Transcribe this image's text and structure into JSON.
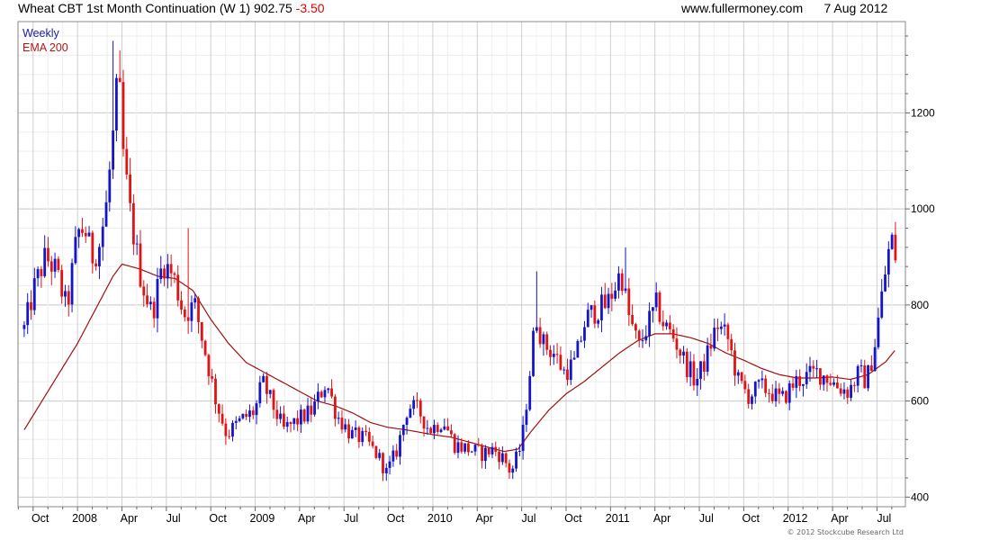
{
  "header": {
    "instrument": "Wheat CBT 1st Month Continuation (W 1) 902.75",
    "change": "-3.50",
    "site": "www.fullermoney.com",
    "date": "7 Aug 2012"
  },
  "legend": {
    "weekly": "Weekly",
    "ema": "EMA 200"
  },
  "copyright": "© 2012 Stockcube Research Ltd",
  "colors": {
    "up": "#1414c8",
    "down": "#e01414",
    "ema": "#a01010",
    "grid": "#d9d9d9"
  },
  "chart_data": {
    "type": "candlestick",
    "y_ticks": [
      "400",
      "600",
      "800",
      "1000",
      "1200"
    ],
    "x_labels": [
      "Oct",
      "2008",
      "Apr",
      "Jul",
      "Oct",
      "2009",
      "Apr",
      "Jul",
      "Oct",
      "2010",
      "Apr",
      "Jul",
      "Oct",
      "2011",
      "Apr",
      "Jul",
      "Oct",
      "2012",
      "Apr",
      "Jul"
    ],
    "ylim": [
      380,
      1390
    ],
    "price_anchors": [
      [
        2007.7,
        750
      ],
      [
        2007.76,
        840
      ],
      [
        2007.82,
        900
      ],
      [
        2007.88,
        870
      ],
      [
        2007.94,
        790
      ],
      [
        2008.0,
        950
      ],
      [
        2008.04,
        960
      ],
      [
        2008.08,
        900
      ],
      [
        2008.12,
        920
      ],
      [
        2008.16,
        1000
      ],
      [
        2008.2,
        1150
      ],
      [
        2008.23,
        1280
      ],
      [
        2008.26,
        1100
      ],
      [
        2008.3,
        980
      ],
      [
        2008.36,
        850
      ],
      [
        2008.42,
        780
      ],
      [
        2008.48,
        890
      ],
      [
        2008.54,
        860
      ],
      [
        2008.6,
        780
      ],
      [
        2008.66,
        800
      ],
      [
        2008.72,
        700
      ],
      [
        2008.78,
        600
      ],
      [
        2008.84,
        530
      ],
      [
        2008.92,
        560
      ],
      [
        2009.0,
        580
      ],
      [
        2009.04,
        640
      ],
      [
        2009.1,
        590
      ],
      [
        2009.16,
        540
      ],
      [
        2009.24,
        560
      ],
      [
        2009.32,
        580
      ],
      [
        2009.4,
        640
      ],
      [
        2009.46,
        570
      ],
      [
        2009.54,
        530
      ],
      [
        2009.62,
        520
      ],
      [
        2009.7,
        480
      ],
      [
        2009.74,
        450
      ],
      [
        2009.8,
        500
      ],
      [
        2009.86,
        590
      ],
      [
        2009.92,
        580
      ],
      [
        2009.98,
        540
      ],
      [
        2010.06,
        560
      ],
      [
        2010.12,
        510
      ],
      [
        2010.2,
        500
      ],
      [
        2010.28,
        490
      ],
      [
        2010.34,
        500
      ],
      [
        2010.4,
        480
      ],
      [
        2010.44,
        450
      ],
      [
        2010.5,
        510
      ],
      [
        2010.54,
        640
      ],
      [
        2010.58,
        780
      ],
      [
        2010.62,
        720
      ],
      [
        2010.68,
        700
      ],
      [
        2010.74,
        660
      ],
      [
        2010.8,
        680
      ],
      [
        2010.86,
        770
      ],
      [
        2010.92,
        790
      ],
      [
        2010.98,
        800
      ],
      [
        2011.06,
        870
      ],
      [
        2011.1,
        780
      ],
      [
        2011.16,
        710
      ],
      [
        2011.2,
        750
      ],
      [
        2011.26,
        800
      ],
      [
        2011.3,
        760
      ],
      [
        2011.36,
        730
      ],
      [
        2011.42,
        680
      ],
      [
        2011.48,
        640
      ],
      [
        2011.54,
        690
      ],
      [
        2011.6,
        760
      ],
      [
        2011.66,
        730
      ],
      [
        2011.72,
        640
      ],
      [
        2011.78,
        610
      ],
      [
        2011.84,
        630
      ],
      [
        2011.9,
        620
      ],
      [
        2011.96,
        600
      ],
      [
        2012.04,
        640
      ],
      [
        2012.1,
        650
      ],
      [
        2012.16,
        660
      ],
      [
        2012.22,
        650
      ],
      [
        2012.28,
        630
      ],
      [
        2012.34,
        620
      ],
      [
        2012.4,
        660
      ],
      [
        2012.44,
        640
      ],
      [
        2012.48,
        700
      ],
      [
        2012.52,
        800
      ],
      [
        2012.56,
        900
      ],
      [
        2012.58,
        940
      ],
      [
        2012.6,
        902.75
      ]
    ],
    "ema_anchors": [
      [
        2007.7,
        540
      ],
      [
        2007.8,
        600
      ],
      [
        2007.9,
        660
      ],
      [
        2008.0,
        720
      ],
      [
        2008.1,
        790
      ],
      [
        2008.2,
        860
      ],
      [
        2008.25,
        885
      ],
      [
        2008.35,
        875
      ],
      [
        2008.45,
        860
      ],
      [
        2008.55,
        855
      ],
      [
        2008.65,
        830
      ],
      [
        2008.75,
        770
      ],
      [
        2008.85,
        720
      ],
      [
        2008.95,
        680
      ],
      [
        2009.05,
        660
      ],
      [
        2009.15,
        640
      ],
      [
        2009.25,
        620
      ],
      [
        2009.35,
        600
      ],
      [
        2009.45,
        590
      ],
      [
        2009.55,
        575
      ],
      [
        2009.65,
        555
      ],
      [
        2009.75,
        545
      ],
      [
        2009.85,
        540
      ],
      [
        2010.0,
        530
      ],
      [
        2010.1,
        525
      ],
      [
        2010.2,
        515
      ],
      [
        2010.3,
        505
      ],
      [
        2010.4,
        495
      ],
      [
        2010.48,
        500
      ],
      [
        2010.55,
        535
      ],
      [
        2010.65,
        580
      ],
      [
        2010.75,
        615
      ],
      [
        2010.85,
        640
      ],
      [
        2010.95,
        670
      ],
      [
        2011.05,
        700
      ],
      [
        2011.15,
        725
      ],
      [
        2011.25,
        740
      ],
      [
        2011.35,
        740
      ],
      [
        2011.45,
        732
      ],
      [
        2011.55,
        720
      ],
      [
        2011.65,
        700
      ],
      [
        2011.75,
        685
      ],
      [
        2011.85,
        668
      ],
      [
        2011.95,
        655
      ],
      [
        2012.05,
        648
      ],
      [
        2012.15,
        648
      ],
      [
        2012.25,
        650
      ],
      [
        2012.35,
        645
      ],
      [
        2012.45,
        655
      ],
      [
        2012.55,
        682
      ],
      [
        2012.6,
        705
      ]
    ],
    "spikes": [
      [
        2008.2,
        1350
      ],
      [
        2008.23,
        1330
      ],
      [
        2008.62,
        960
      ],
      [
        2010.58,
        870
      ],
      [
        2011.08,
        920
      ]
    ]
  }
}
